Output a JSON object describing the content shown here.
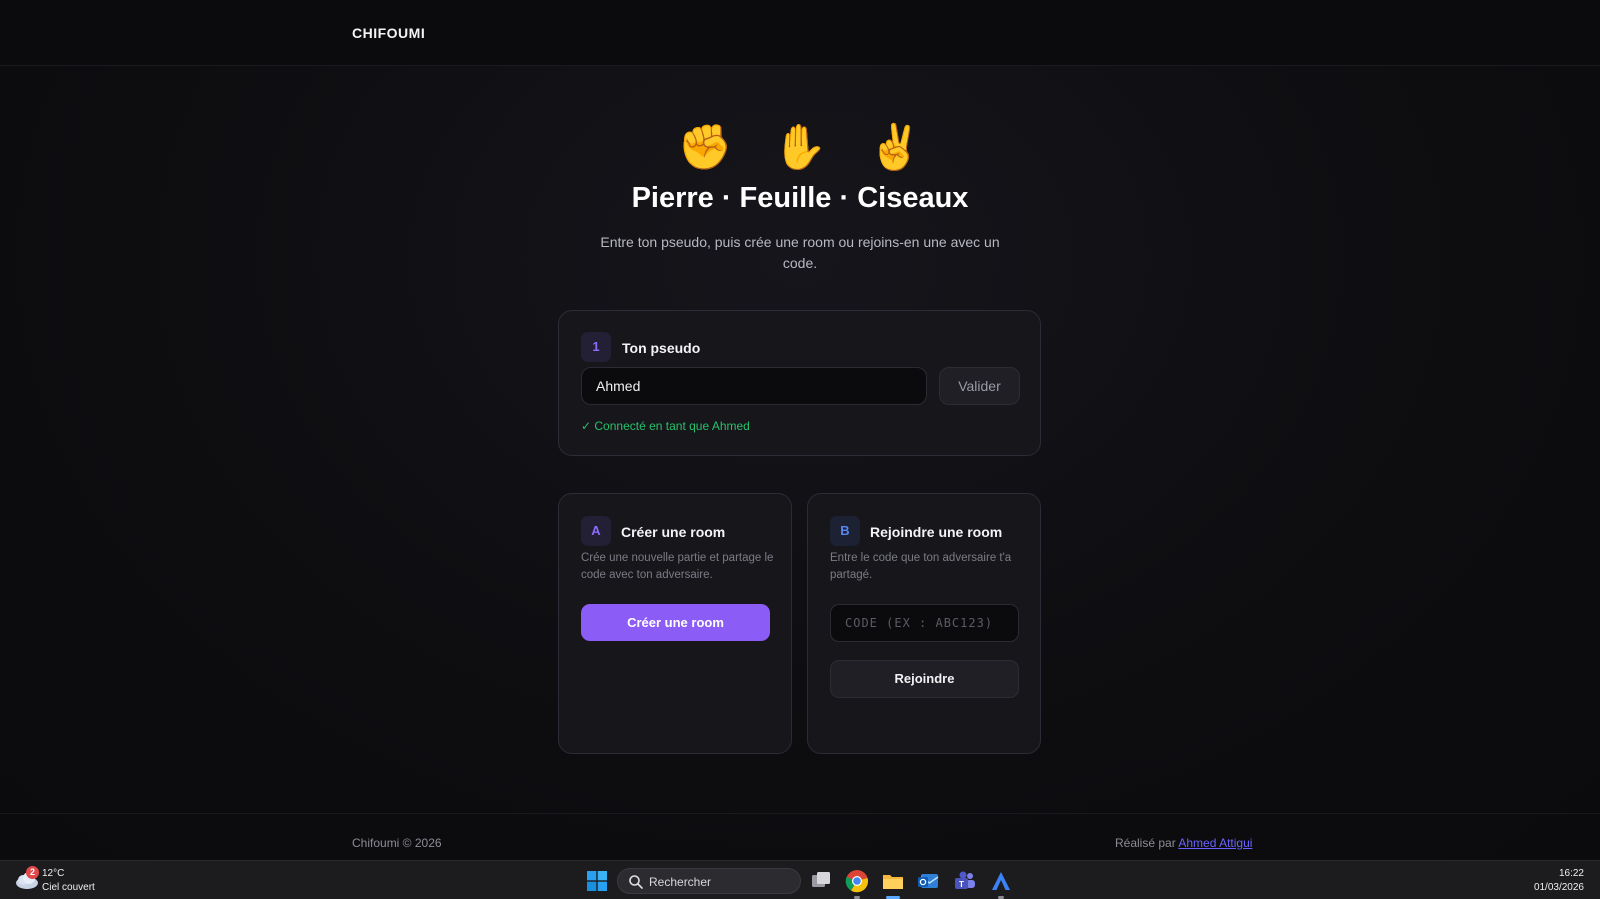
{
  "header": {
    "brand": "CHIFOUMI"
  },
  "hero": {
    "emojis": [
      "✊",
      "✋",
      "✌️"
    ],
    "title": "Pierre · Feuille · Ciseaux",
    "subtitle": "Entre ton pseudo, puis crée une room ou rejoins-en une avec un code."
  },
  "pseudo_card": {
    "step": "1",
    "title": "Ton pseudo",
    "input_value": "Ahmed",
    "validate_label": "Valider",
    "status": "✓ Connecté en tant que Ahmed"
  },
  "create_card": {
    "step": "A",
    "title": "Créer une room",
    "description": "Crée une nouvelle partie et partage le code avec ton adversaire.",
    "button_label": "Créer une room"
  },
  "join_card": {
    "step": "B",
    "title": "Rejoindre une room",
    "description": "Entre le code que ton adversaire t'a partagé.",
    "code_placeholder": "CODE (EX : ABC123)",
    "button_label": "Rejoindre"
  },
  "footer": {
    "copyright": "Chifoumi © 2026",
    "credit_prefix": "Réalisé par ",
    "credit_name": "Ahmed Attigui"
  },
  "taskbar": {
    "weather_badge": "2",
    "weather_temp": "12°C",
    "weather_desc": "Ciel couvert",
    "search_label": "Rechercher",
    "time": "16:22",
    "date": "01/03/2026"
  },
  "colors": {
    "accent": "#8b5cf6",
    "success": "#27c06b",
    "link": "#6c63ff",
    "background": "#0d0d10",
    "card": "#17171b"
  }
}
